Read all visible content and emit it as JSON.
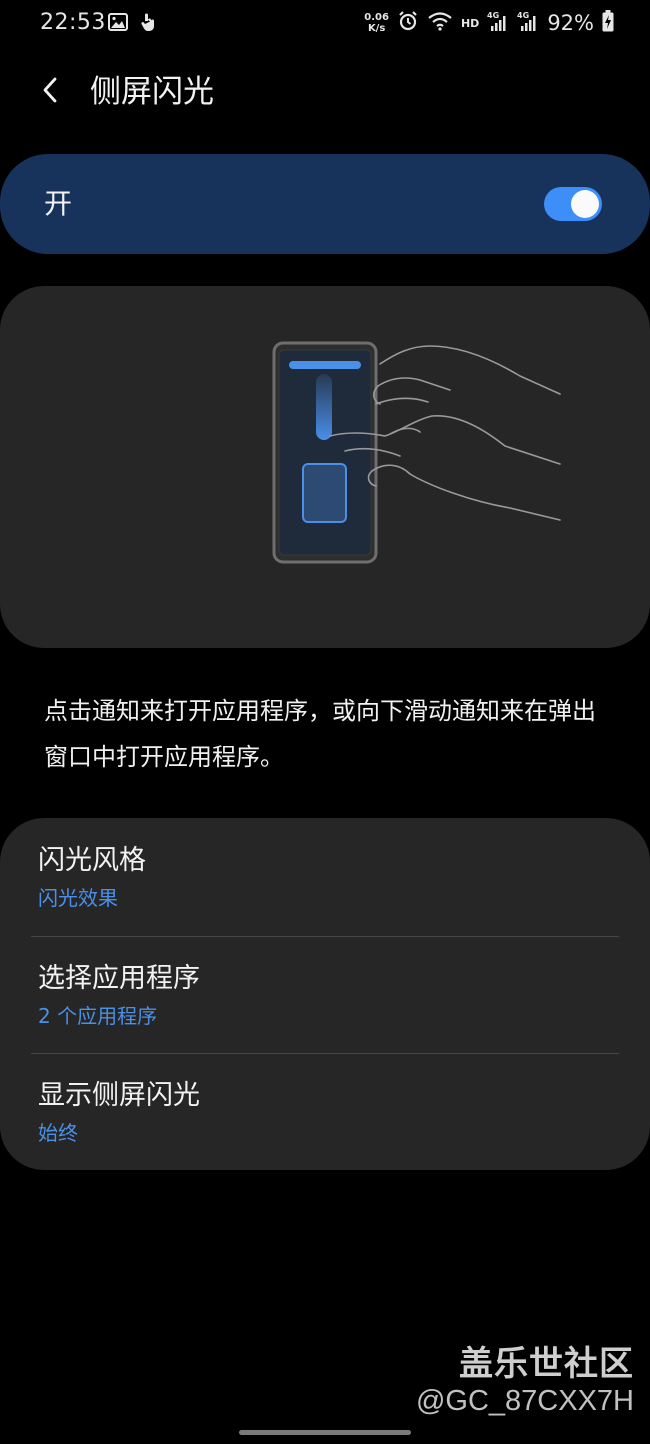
{
  "status_bar": {
    "time": "22:53",
    "net_speed_value": "0.06",
    "net_speed_unit": "K/s",
    "hd_label": "HD",
    "battery_percent": "92%",
    "icons": [
      "image-icon",
      "touch-icon",
      "alarm-icon",
      "wifi-icon",
      "signal-4g-icon",
      "signal-4g-icon",
      "battery-charging-icon"
    ]
  },
  "header": {
    "back_icon": "chevron-left-icon",
    "title": "侧屏闪光"
  },
  "master_switch": {
    "label": "开",
    "state": "on",
    "accent_color": "#3e8ef7"
  },
  "description": "点击通知来打开应用程序，或向下滑动通知来在弹出窗口中打开应用程序。",
  "options": [
    {
      "title": "闪光风格",
      "subtitle": "闪光效果"
    },
    {
      "title": "选择应用程序",
      "subtitle": "2 个应用程序"
    },
    {
      "title": "显示侧屏闪光",
      "subtitle": "始终"
    }
  ],
  "watermark": {
    "title": "盖乐世社区",
    "handle": "@GC_87CXX7H"
  },
  "colors": {
    "background": "#000000",
    "card": "#262626",
    "switch_card": "#17335c",
    "subtitle": "#4b8fe6"
  }
}
